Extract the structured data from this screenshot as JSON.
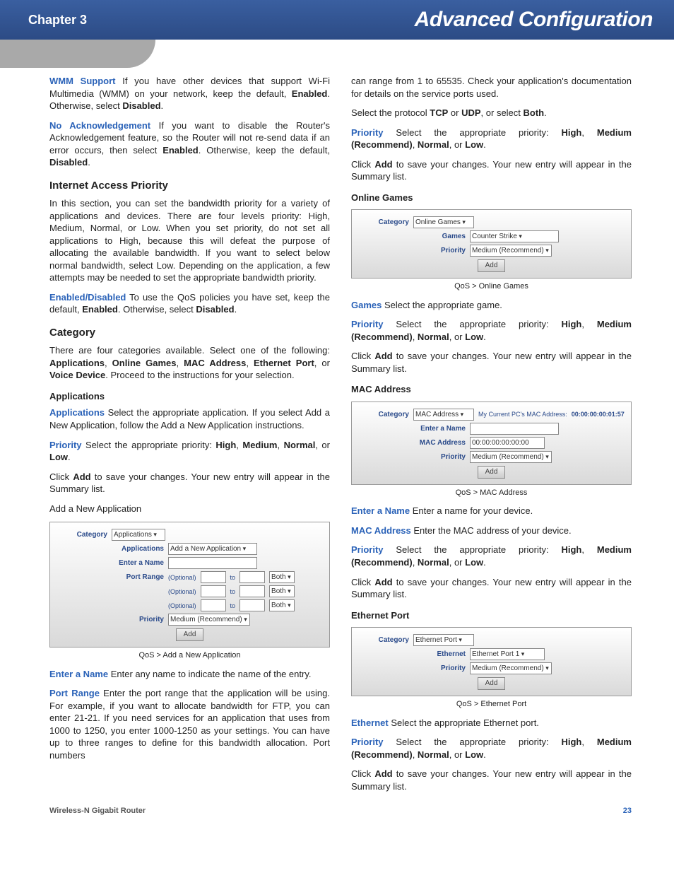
{
  "header": {
    "chapter": "Chapter 3",
    "title": "Advanced Configuration"
  },
  "col1": {
    "wmm_l": "WMM Support",
    "wmm_t1": "  If you have other devices that support Wi-Fi Multimedia (WMM) on your network, keep the default, ",
    "wmm_b1": "Enabled",
    "wmm_t2": ". Otherwise, select ",
    "wmm_b2": "Disabled",
    "wmm_t3": ".",
    "noack_l": "No Acknowledgement",
    "noack_t1": "  If you want to disable the Router's Acknowledgement feature, so the Router will not re-send data if an error occurs, then select ",
    "noack_b1": "Enabled",
    "noack_t2": ". Otherwise, keep the default, ",
    "noack_b2": "Disabled",
    "noack_t3": ".",
    "h_iap": "Internet Access Priority",
    "iap_p": "In this section, you can set the bandwidth priority for a variety of applications and devices. There are four levels priority: High, Medium, Normal, or Low. When you set priority, do not set all applications to High, because this will defeat the purpose of allocating the available bandwidth. If you want to select below normal bandwidth, select Low. Depending on the application, a few attempts may be needed to set the appropriate bandwidth priority.",
    "ed_l": "Enabled/Disabled",
    "ed_t1": "  To use the QoS policies you have set, keep the default, ",
    "ed_b1": "Enabled",
    "ed_t2": ". Otherwise, select ",
    "ed_b2": "Disabled",
    "ed_t3": ".",
    "h_cat": "Category",
    "cat_t1": "There are four categories available. Select one of the following: ",
    "cat_b1": "Applications",
    "cat_s1": ", ",
    "cat_b2": "Online Games",
    "cat_s2": ", ",
    "cat_b3": "MAC Address",
    "cat_s3": ", ",
    "cat_b4": "Ethernet Port",
    "cat_s4": ", or ",
    "cat_b5": "Voice Device",
    "cat_t2": ". Proceed to the instructions for your selection.",
    "h_apps": "Applications",
    "apps_l": "Applications",
    "apps_t": "  Select the appropriate application. If you select Add a New Application, follow the Add a New Application instructions.",
    "prio_l": "Priority",
    "prio_t1": "  Select the appropriate priority: ",
    "prio_b1": "High",
    "prio_s1": ", ",
    "prio_b2": "Medium",
    "prio_s2": ", ",
    "prio_b3": "Normal",
    "prio_s3": ", or ",
    "prio_b4": "Low",
    "prio_t2": ".",
    "add_t1": "Click ",
    "add_b": "Add",
    "add_t2": " to save your changes. Your new entry will appear in the Summary list.",
    "addnew": "Add a New Application",
    "fig1": {
      "cat": "Category",
      "catv": "Applications",
      "apps": "Applications",
      "appsv": "Add a New Application",
      "name": "Enter a Name",
      "pr": "Port Range",
      "opt": "(Optional)",
      "to": "to",
      "both": "Both",
      "prio": "Priority",
      "priov": "Medium (Recommend)",
      "add": "Add"
    },
    "cap1": "QoS > Add a New Application",
    "ename_l": "Enter a Name",
    "ename_t": "  Enter any name to indicate the name of the entry.",
    "prange_l": "Port Range",
    "prange_t": "  Enter the port range that the application will be using. For example, if you want to allocate bandwidth for FTP, you can enter 21-21. If you need services for an application that uses from 1000 to 1250, you enter 1000-1250 as your settings. You can have up to three ranges to define for this bandwidth allocation. Port numbers"
  },
  "col2": {
    "cont": "can range from 1 to 65535. Check your application's documentation for details on the service ports used.",
    "proto_t1": "Select the protocol ",
    "proto_b1": "TCP",
    "proto_t2": " or ",
    "proto_b2": "UDP",
    "proto_t3": ", or select ",
    "proto_b3": "Both",
    "proto_t4": ".",
    "prio_l": "Priority",
    "prio_t1": "  Select the appropriate priority: ",
    "prio_b1": "High",
    "prio_s1": ", ",
    "prio_b2": "Medium (Recommend)",
    "prio_s2": ", ",
    "prio_b3": "Normal",
    "prio_s3": ", or ",
    "prio_b4": "Low",
    "prio_t2": ".",
    "add_t1": "Click ",
    "add_b": "Add",
    "add_t2": " to save your changes. Your new entry will appear in the Summary list.",
    "h_og": "Online Games",
    "fig2": {
      "cat": "Category",
      "catv": "Online Games",
      "games": "Games",
      "gamesv": "Counter Strike",
      "prio": "Priority",
      "priov": "Medium (Recommend)",
      "add": "Add"
    },
    "cap2": "QoS > Online Games",
    "games_l": "Games",
    "games_t": "  Select the appropriate game.",
    "h_mac": "MAC Address",
    "fig3": {
      "cat": "Category",
      "catv": "MAC Address",
      "mypc": "My Current PC's MAC Address:",
      "mac": "00:00:00:00:01:57",
      "name": "Enter a Name",
      "maclbl": "MAC Address",
      "macv": "00:00:00:00:00:00",
      "prio": "Priority",
      "priov": "Medium (Recommend)",
      "add": "Add"
    },
    "cap3": "QoS > MAC Address",
    "ename_l": "Enter a Name",
    "ename_t": "  Enter a name for your device.",
    "mac_l": "MAC Address",
    "mac_t": "  Enter the MAC address of your device.",
    "h_eth": "Ethernet Port",
    "fig4": {
      "cat": "Category",
      "catv": "Ethernet Port",
      "eth": "Ethernet",
      "ethv": "Ethernet Port 1",
      "prio": "Priority",
      "priov": "Medium (Recommend)",
      "add": "Add"
    },
    "cap4": "QoS > Ethernet Port",
    "eth_l": "Ethernet",
    "eth_t": "  Select the appropriate Ethernet port."
  },
  "footer": {
    "product": "Wireless-N Gigabit Router",
    "page": "23"
  }
}
